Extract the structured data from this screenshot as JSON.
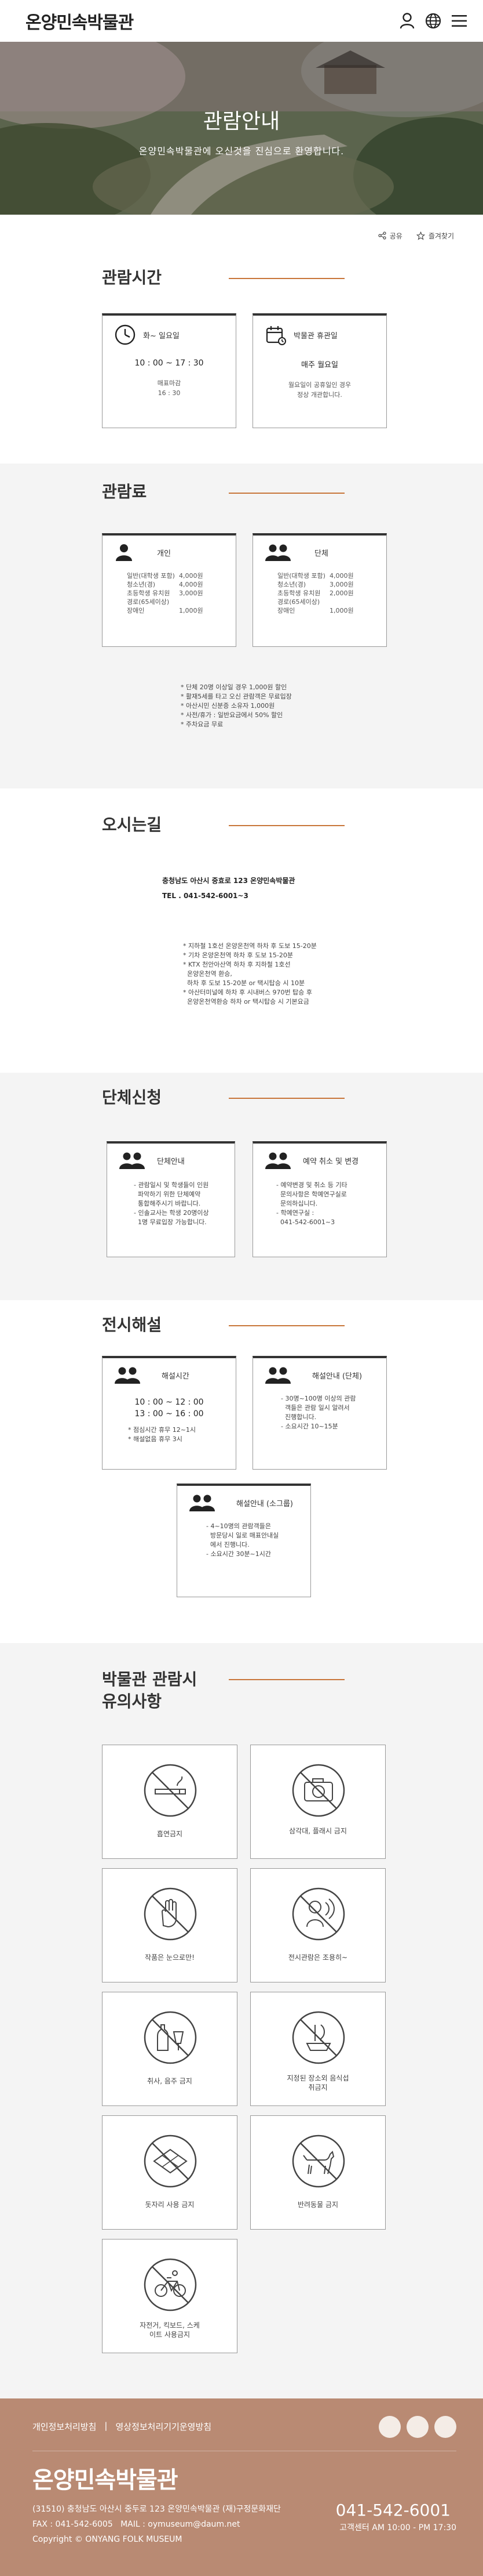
{
  "header": {
    "logo": "온양민속박물관",
    "user_icon": "user-icon",
    "globe_icon": "globe-icon",
    "menu_icon": "menu-icon"
  },
  "hero": {
    "title": "관람안내",
    "subtitle": "온양민속박물관에 오신것을 진심으로 환영합니다."
  },
  "share": {
    "share_label": "공유",
    "favorite_label": "즐겨찾기"
  },
  "hours": {
    "title": "관람시간",
    "open": {
      "title": "화~ 일요일",
      "time": "10 : 00 ~ 17 : 30",
      "last_label": "매표마감",
      "last_time": "16 : 30"
    },
    "closed": {
      "title": "박물관 휴관일",
      "day": "매주 월요일",
      "note1": "월요일이 공휴일인 경우",
      "note2": "정상 개관합니다."
    }
  },
  "fees": {
    "title": "관람료",
    "individual": {
      "title": "개인",
      "rows": [
        [
          "일반(대학생 포함)",
          "4,000원"
        ],
        [
          "청소년(경)",
          "4,000원"
        ],
        [
          "초등학생 유치원",
          "3,000원"
        ],
        [
          "경로(65세이상)",
          ""
        ],
        [
          "장애인",
          "1,000원"
        ]
      ]
    },
    "group": {
      "title": "단체",
      "rows": [
        [
          "일반(대학생 포함)",
          "4,000원"
        ],
        [
          "청소년(경)",
          "3,000원"
        ],
        [
          "초등학생 유치원",
          "2,000원"
        ],
        [
          "경로(65세이상)",
          ""
        ],
        [
          "장애인",
          "1,000원"
        ]
      ]
    },
    "notes": [
      "* 단체 20명 이상일 경우 1,000원 할인",
      "* 활재5세를 타고 오신 관람객은 무료입장",
      "* 아산시민 신분증 소유자 1,000원",
      "* 사전/휴가 : 일반요금에서 50% 할인",
      "* 주차요금 무료"
    ]
  },
  "directions": {
    "title": "오시는길",
    "address": "충청남도 아산시 중효로 123 온양민속박물관",
    "tel": "TEL . 041-542-6001~3",
    "notes": [
      "* 지하철 1호선 온양온천역 하차 후 도보 15-20분",
      "* 기차 온양온천역 하차 후 도보 15-20분",
      "* KTX 천안아산역 하차 후 지하철 1호선",
      "  온양온천역 환승,",
      "  하차 후 도보 15-20분 or 택시탑승 시 10분",
      "* 아산터미널에 하차 후 시내버스 970번 탑승 후",
      "  온양온천역환승 하차 or 택시탑승 시 기본요금"
    ]
  },
  "group_apply": {
    "title": "단체신청",
    "guide": {
      "title": "단체안내",
      "lines": [
        "- 관람일시 및 학생들이 인원",
        "  파악하기 위한 단체예약",
        "  통합해주시기 바랍니다.",
        "- 인솔교사는 학생 20명이상",
        "  1명 무료입장 가능합니다."
      ]
    },
    "cancel": {
      "title": "예약 취소 및 변경",
      "lines": [
        "- 예약변경 및 취소 등 기타",
        "  문의사항은 학예연구실로",
        "  문의하십니다.",
        "- 학예연구실 :",
        "  041-542-6001~3"
      ]
    }
  },
  "exhibit": {
    "title": "전시해설",
    "times": {
      "title": "해설시간",
      "time1": "10 : 00 ~ 12 : 00",
      "time2": "13 : 00 ~ 16 : 00",
      "notes": [
        "* 점심시간 휴무 12~1시",
        "* 해설없음 휴무 3시"
      ]
    },
    "group_guide": {
      "title": "해설안내 (단체)",
      "lines": [
        "- 30명~100명 이상의 관람",
        "  객들은 관람 일시 알려서",
        "  진행합니다.",
        "- 소요시간 10~15분"
      ]
    },
    "small_guide": {
      "title": "해설안내 (소그룹)",
      "lines": [
        "- 4~10명의 관람객들은",
        "  방문당시 일로 매표안내실",
        "  에서 진행니다.",
        "- 소요시간 30분~1시간"
      ]
    }
  },
  "rules": {
    "title_line1": "박물관 관람시",
    "title_line2": "유의사항",
    "items": [
      {
        "label": "흡연금지",
        "icon": "no-smoking-icon"
      },
      {
        "label": "삼각대, 플래시 금지",
        "icon": "no-camera-icon"
      },
      {
        "label": "작품은 눈으로만!",
        "icon": "no-touch-icon"
      },
      {
        "label": "전시관람은 조용히~",
        "icon": "quiet-icon"
      },
      {
        "label": "취사, 음주 금지",
        "icon": "no-drinking-icon"
      },
      {
        "label": "지정된 장소외 음식섭취금지",
        "icon": "no-food-icon"
      },
      {
        "label": "돗자리 사용 금지",
        "icon": "no-mat-icon"
      },
      {
        "label": "반려동물 금지",
        "icon": "no-pets-icon"
      },
      {
        "label": "자전거, 킥보드, 스케이트 사용금지",
        "icon": "no-bicycle-icon"
      }
    ]
  },
  "footer": {
    "privacy": "개인정보처리방침",
    "separator": "|",
    "video": "영상정보처리기기운영방침",
    "logo": "온양민속박물관",
    "address": "(31510) 충청남도 아산시 중두로 123 온양민속박물관 (재)구정문화재단",
    "fax": "FAX : 041-542-6005",
    "mail": "MAIL : oymuseum@daum.net",
    "phone": "041-542-6001",
    "hours": "고객센터 AM 10:00 - PM 17:30",
    "copyright": "Copyright © ONYANG FOLK MUSEUM"
  },
  "colors": {
    "accent": "#c8763a",
    "footer_bg": "#b98a73",
    "section_gray": "#f4f4f4",
    "card_border": "#333333"
  }
}
